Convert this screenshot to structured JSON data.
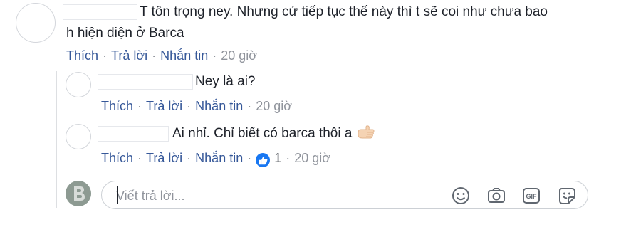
{
  "comments": [
    {
      "line1": "T tôn trọng ney. Nhưng cứ tiếp tục thế này thì t sẽ coi như chưa bao",
      "line2": "h hiện diện ở Barca",
      "actions": {
        "like": "Thích",
        "reply": "Trả lời",
        "message": "Nhắn tin",
        "time": "20 giờ"
      }
    },
    {
      "text": "Ney là ai?",
      "actions": {
        "like": "Thích",
        "reply": "Trả lời",
        "message": "Nhắn tin",
        "time": "20 giờ"
      }
    },
    {
      "text": "Ai nhỉ. Chỉ biết có barca thôi a",
      "emoji": "backhand-index-pointing-right",
      "actions": {
        "like": "Thích",
        "reply": "Trả lời",
        "message": "Nhắn tin",
        "reactions": "1",
        "time": "20 giờ"
      }
    }
  ],
  "separator": "·",
  "reply_box": {
    "placeholder": "Viết trả lời...",
    "tools": [
      "emoji-icon",
      "camera-icon",
      "gif-icon",
      "sticker-icon"
    ]
  },
  "colors": {
    "link": "#365899",
    "meta": "#90949c",
    "like_badge": "#1877f2"
  }
}
